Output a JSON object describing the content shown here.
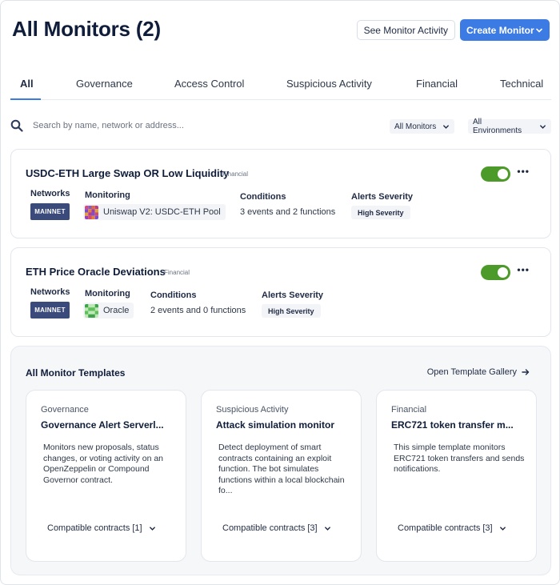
{
  "header": {
    "title": "All Monitors (2)",
    "activity_button": "See Monitor Activity",
    "create_button": "Create Monitor"
  },
  "tabs": [
    {
      "label": "All",
      "active": true
    },
    {
      "label": "Governance"
    },
    {
      "label": "Access Control"
    },
    {
      "label": "Suspicious Activity"
    },
    {
      "label": "Financial"
    },
    {
      "label": "Technical"
    }
  ],
  "search": {
    "placeholder": "Search by name, network or address...",
    "filter_monitors": "All Monitors",
    "filter_envs": "All Environments"
  },
  "monitor_labels": {
    "networks": "Networks",
    "monitoring": "Monitoring",
    "conditions": "Conditions",
    "alerts_severity": "Alerts Severity"
  },
  "monitors": [
    {
      "name": "USDC-ETH Large Swap OR Low Liquidity",
      "tag": "Financial",
      "enabled": true,
      "network": "MAINNET",
      "monitoring": "Uniswap V2: USDC-ETH Pool",
      "conditions": "3 events and 2 functions",
      "severity": "High Severity"
    },
    {
      "name": "ETH Price Oracle Deviations",
      "tag": "Financial",
      "enabled": true,
      "network": "MAINNET",
      "monitoring": "Oracle",
      "conditions": "2 events and 0 functions",
      "severity": "High Severity"
    }
  ],
  "templates": {
    "title": "All Monitor Templates",
    "gallery_link": "Open Template Gallery",
    "items": [
      {
        "category": "Governance",
        "name": "Governance Alert Serverl...",
        "description": "Monitors new proposals, status changes, or voting activity on an OpenZeppelin or Compound Governor contract.",
        "compatible": "Compatible contracts [1]"
      },
      {
        "category": "Suspicious Activity",
        "name": "Attack simulation monitor",
        "description": "Detect deployment of smart contracts containing an exploit function. The bot simulates functions within a local blockchain fo...",
        "compatible": "Compatible contracts [3]"
      },
      {
        "category": "Financial",
        "name": "ERC721 token transfer m...",
        "description": "This simple template monitors ERC721 token transfers and sends notifications.",
        "compatible": "Compatible contracts [3]"
      }
    ]
  },
  "colors": {
    "accent": "#3b7be3",
    "toggle_on": "#4c9a2a",
    "network_badge": "#3a4a7a"
  }
}
